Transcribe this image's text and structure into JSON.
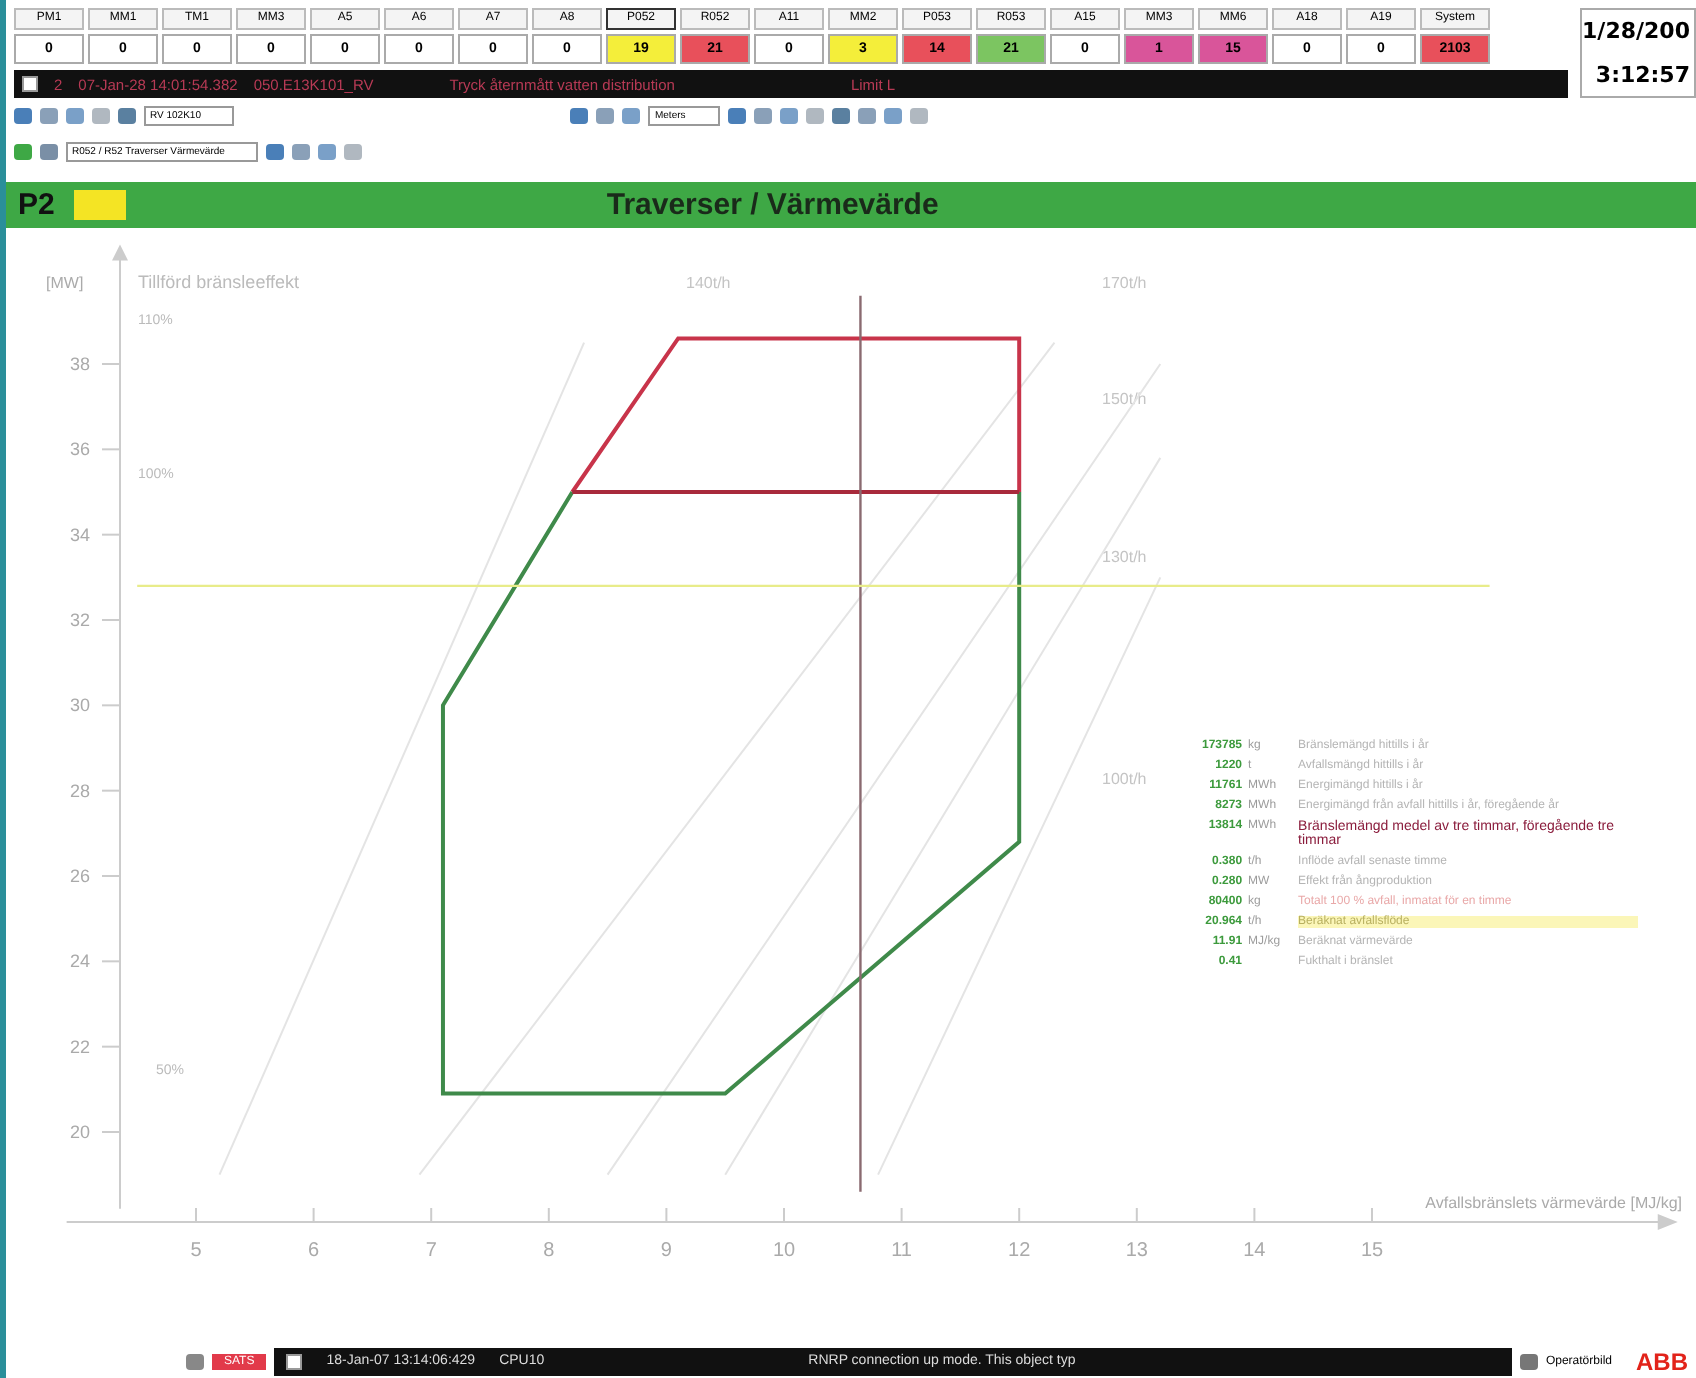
{
  "alarm_groups": [
    {
      "label": "PM1",
      "count": "0",
      "color": "#ffffff",
      "selected": false
    },
    {
      "label": "MM1",
      "count": "0",
      "color": "#ffffff",
      "selected": false
    },
    {
      "label": "TM1",
      "count": "0",
      "color": "#ffffff",
      "selected": false
    },
    {
      "label": "MM3",
      "count": "0",
      "color": "#ffffff",
      "selected": false
    },
    {
      "label": "A5",
      "count": "0",
      "color": "#ffffff",
      "selected": false
    },
    {
      "label": "A6",
      "count": "0",
      "color": "#ffffff",
      "selected": false
    },
    {
      "label": "A7",
      "count": "0",
      "color": "#ffffff",
      "selected": false
    },
    {
      "label": "A8",
      "count": "0",
      "color": "#ffffff",
      "selected": false
    },
    {
      "label": "P052",
      "count": "19",
      "color": "#f4ee3a",
      "selected": true
    },
    {
      "label": "R052",
      "count": "21",
      "color": "#e8505b",
      "selected": false
    },
    {
      "label": "A11",
      "count": "0",
      "color": "#ffffff",
      "selected": false
    },
    {
      "label": "MM2",
      "count": "3",
      "color": "#f4ee3a",
      "selected": false
    },
    {
      "label": "P053",
      "count": "14",
      "color": "#e8505b",
      "selected": false
    },
    {
      "label": "R053",
      "count": "21",
      "color": "#7cc561",
      "selected": false
    },
    {
      "label": "A15",
      "count": "0",
      "color": "#ffffff",
      "selected": false
    },
    {
      "label": "MM3",
      "count": "1",
      "color": "#d9559a",
      "selected": false
    },
    {
      "label": "MM6",
      "count": "15",
      "color": "#d9559a",
      "selected": false
    },
    {
      "label": "A18",
      "count": "0",
      "color": "#ffffff",
      "selected": false
    },
    {
      "label": "A19",
      "count": "0",
      "color": "#ffffff",
      "selected": false
    },
    {
      "label": "System",
      "count": "2103",
      "color": "#e8505b",
      "selected": false
    }
  ],
  "clock": {
    "date": "1/28/200",
    "time": "3:12:57"
  },
  "alarm_line": {
    "checked": false,
    "index": "2",
    "timestamp": "07-Jan-28 14:01:54.382",
    "object": "050.E13K101_RV",
    "message": "Tryck åternmått vatten distribution",
    "limit": "Limit L"
  },
  "toolbar": {
    "object_field": "RV 102K10",
    "view_field": "Meters",
    "path_field": "R052 / R52 Traverser Värmevärde"
  },
  "header": {
    "unit": "P2",
    "title": "Traverser / Värmevärde"
  },
  "chart": {
    "subtitle": "Tillförd bränsleeffekt",
    "percent_labels": [
      "110%",
      "100%",
      "50%"
    ],
    "flow_labels": [
      "140t/h",
      "170t/h",
      "150t/h",
      "130t/h",
      "100t/h"
    ],
    "chart_data": {
      "type": "line",
      "ylabel": "[MW]",
      "xlabel": "Avfallsbränslets värmevärde [MJ/kg]",
      "xticks": [
        5,
        6,
        7,
        8,
        9,
        10,
        11,
        12,
        13,
        14,
        15
      ],
      "yticks": [
        20,
        22,
        24,
        26,
        28,
        30,
        32,
        34,
        36,
        38
      ],
      "xlim": [
        3.9,
        17.6
      ],
      "ylim": [
        18.2,
        40.8
      ],
      "series": [
        {
          "color": "#e4e4e4",
          "x": [
            5.2,
            8.3
          ],
          "values": [
            19.0,
            38.5
          ]
        },
        {
          "color": "#e4e4e4",
          "x": [
            6.9,
            12.3
          ],
          "values": [
            19.0,
            38.5
          ]
        },
        {
          "color": "#e4e4e4",
          "x": [
            8.5,
            13.2
          ],
          "values": [
            19.0,
            38.0
          ]
        },
        {
          "color": "#e4e4e4",
          "x": [
            9.5,
            13.2
          ],
          "values": [
            19.0,
            35.8
          ]
        },
        {
          "color": "#e4e4e4",
          "x": [
            10.8,
            13.2
          ],
          "values": [
            19.0,
            33.0
          ]
        },
        {
          "color": "#3f8a4a",
          "x": [
            8.2,
            7.1,
            7.1,
            9.5,
            12.0,
            12.0
          ],
          "values": [
            35.0,
            30.0,
            20.9,
            20.9,
            26.8,
            35.0
          ]
        },
        {
          "color": "#c8344a",
          "x": [
            8.2,
            9.1,
            12.0,
            12.0
          ],
          "values": [
            35.0,
            38.6,
            38.6,
            35.0
          ]
        },
        {
          "color": "#a82a3c",
          "x": [
            8.2,
            12.0
          ],
          "values": [
            35.0,
            35.0
          ]
        },
        {
          "color": "#8a6a70",
          "x": [
            10.65,
            10.65
          ],
          "values": [
            18.6,
            39.6
          ]
        },
        {
          "color": "#e8ec8a",
          "x": [
            4.5,
            16.0
          ],
          "values": [
            32.8,
            32.8
          ]
        }
      ]
    }
  },
  "readings": [
    {
      "value": "173785",
      "unit": "kg",
      "text": "Bränslemängd hittills i år",
      "kind": "normal"
    },
    {
      "value": "1220",
      "unit": "t",
      "text": "Avfallsmängd hittills i år",
      "kind": "normal"
    },
    {
      "value": "11761",
      "unit": "MWh",
      "text": "Energimängd hittills i år",
      "kind": "normal"
    },
    {
      "value": "8273",
      "unit": "MWh",
      "text": "Energimängd från avfall hittills i år, föregående år",
      "kind": "normal"
    },
    {
      "value": "13814",
      "unit": "MWh",
      "text": "Bränslemängd medel av tre timmar, föregående tre timmar",
      "kind": "alert"
    },
    {
      "value": "0.380",
      "unit": "t/h",
      "text": "Inflöde avfall senaste timme",
      "kind": "normal"
    },
    {
      "value": "0.280",
      "unit": "MW",
      "text": "Effekt från ångproduktion",
      "kind": "normal"
    },
    {
      "value": "80400",
      "unit": "kg",
      "text": "Totalt 100 % avfall, inmatat för en timme",
      "kind": "warning"
    },
    {
      "value": "20.964",
      "unit": "t/h",
      "text": "Beräknat avfallsflöde",
      "kind": "highlight"
    },
    {
      "value": "11.91",
      "unit": "MJ/kg",
      "text": "Beräknat värmevärde",
      "kind": "normal"
    },
    {
      "value": "0.41",
      "text": "Fukthalt i bränslet",
      "kind": "normal"
    }
  ],
  "status_bar": {
    "badge": "SATS",
    "checked": false,
    "timestamp": "18-Jan-07 13:14:06:429",
    "node": "CPU10",
    "message": "RNRP connection up mode. This object typ",
    "workplace": "Operatörbild",
    "logo": "ABB"
  }
}
